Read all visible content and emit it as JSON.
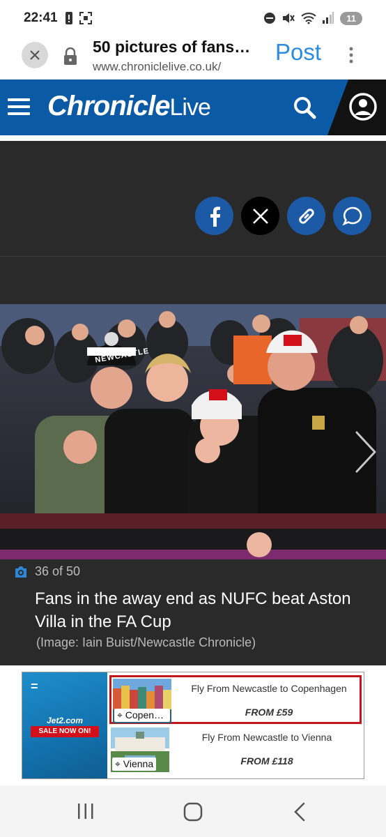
{
  "status_bar": {
    "time": "22:41",
    "battery": "11"
  },
  "browser": {
    "title": "50 pictures of fans…",
    "url": "www.chroniclelive.co.uk/",
    "post_label": "Post"
  },
  "site": {
    "logo_bold": "Chronicle",
    "logo_light": "Live"
  },
  "gallery": {
    "counter": "36 of 50",
    "caption": "Fans in the away end as NUFC beat Aston Villa in the FA Cup",
    "credit": "(Image: Iain Buist/Newcastle Chronicle)",
    "scarf_text": "NEWCASTLE"
  },
  "ad": {
    "brand": "Jet2.com",
    "sale": "SALE NOW ON!",
    "deals": [
      {
        "tag": "Copenh…",
        "title": "Fly From Newcastle to Copenhagen",
        "price": "FROM £59"
      },
      {
        "tag": "Vienna",
        "title": "Fly From Newcastle to Vienna",
        "price": "FROM £118"
      }
    ]
  },
  "colors": {
    "brand_blue": "#0a5aa6",
    "share_blue": "#1c5aa6",
    "link_blue": "#2b8be0"
  }
}
